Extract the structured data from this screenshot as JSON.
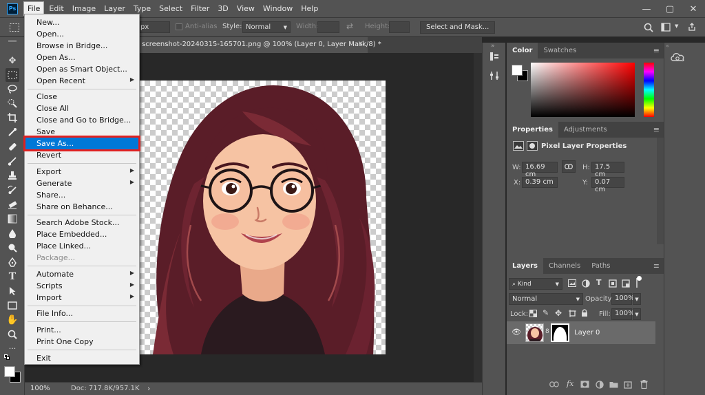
{
  "app": {
    "logo": "Ps"
  },
  "menubar": [
    "File",
    "Edit",
    "Image",
    "Layer",
    "Type",
    "Select",
    "Filter",
    "3D",
    "View",
    "Window",
    "Help"
  ],
  "window_controls": {
    "minimize": "—",
    "restore": "▢",
    "close": "✕"
  },
  "options": {
    "feather_unit": "px",
    "anti_alias": "Anti-alias",
    "style_label": "Style:",
    "style_value": "Normal",
    "width_label": "Width:",
    "height_label": "Height:",
    "select_mask": "Select and Mask..."
  },
  "document": {
    "tab_title": "screenshot-20240315-165701.png @ 100% (Layer 0, Layer Mask/8) *",
    "close_glyph": "×"
  },
  "status": {
    "zoom": "100%",
    "doc_info": "Doc: 717.8K/957.1K",
    "arrow": "›"
  },
  "file_menu": {
    "items": [
      "New...",
      "Open...",
      "Browse in Bridge...",
      "Open As...",
      "Open as Smart Object...",
      "Open Recent",
      "Close",
      "Close All",
      "Close and Go to Bridge...",
      "Save",
      "Save As...",
      "Revert",
      "Export",
      "Generate",
      "Share...",
      "Share on Behance...",
      "Search Adobe Stock...",
      "Place Embedded...",
      "Place Linked...",
      "Package...",
      "Automate",
      "Scripts",
      "Import",
      "File Info...",
      "Print...",
      "Print One Copy",
      "Exit"
    ]
  },
  "panels": {
    "color_tabs": [
      "Color",
      "Swatches"
    ],
    "properties_tabs": [
      "Properties",
      "Adjustments"
    ],
    "properties_title": "Pixel Layer Properties",
    "w_label": "W:",
    "w_value": "16.69 cm",
    "h_label": "H:",
    "h_value": "17.5 cm",
    "x_label": "X:",
    "x_value": "0.39 cm",
    "y_label": "Y:",
    "y_value": "0.07 cm",
    "layers_tabs": [
      "Layers",
      "Channels",
      "Paths"
    ],
    "kind_label": "Kind",
    "blend_mode": "Normal",
    "opacity_label": "Opacity:",
    "opacity_value": "100%",
    "lock_label": "Lock:",
    "fill_label": "Fill:",
    "fill_value": "100%",
    "layer_name": "Layer 0",
    "menu_glyph": "≡"
  },
  "colors": {
    "accent_highlight": "#0078d7",
    "annotation_box": "#e02020",
    "foreground": "#ffffff",
    "background": "#000000"
  }
}
